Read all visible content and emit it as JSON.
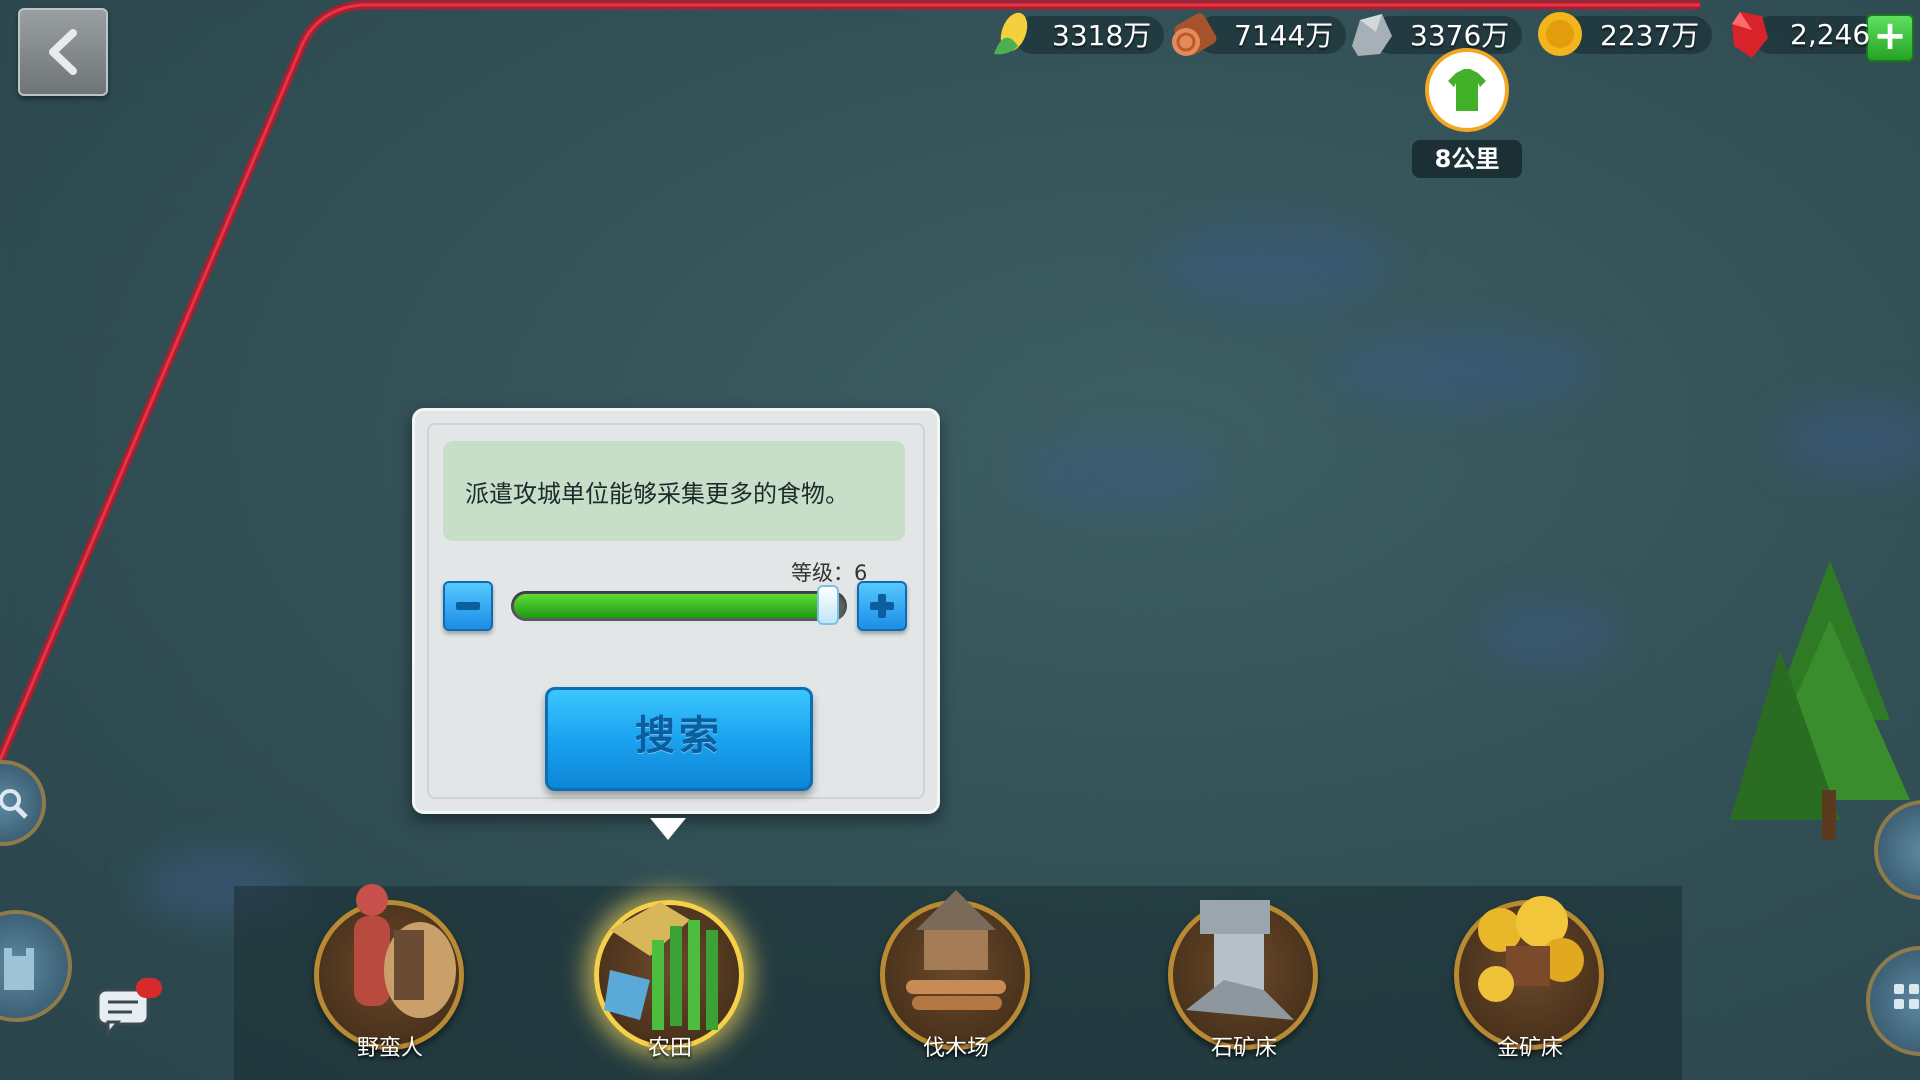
{
  "resources": [
    {
      "name": "food",
      "icon": "corn-icon",
      "value": "3318万"
    },
    {
      "name": "wood",
      "icon": "log-icon",
      "value": "7144万"
    },
    {
      "name": "stone",
      "icon": "stone-icon",
      "value": "3376万"
    },
    {
      "name": "gold",
      "icon": "gold-coin-icon",
      "value": "2237万"
    },
    {
      "name": "gems",
      "icon": "red-gem-icon",
      "value": "2,246"
    }
  ],
  "marker": {
    "distance_label": "8公里",
    "icon": "green-shirt-icon"
  },
  "search_panel": {
    "tip_text": "派遣攻城单位能够采集更多的食物。",
    "level_label": "等级：6",
    "level_fill": 0.95,
    "search_label": "搜索"
  },
  "categories": [
    {
      "id": "barbarian",
      "label": "野蛮人",
      "active": false
    },
    {
      "id": "farm",
      "label": "农田",
      "active": true
    },
    {
      "id": "lumber",
      "label": "伐木场",
      "active": false
    },
    {
      "id": "stone",
      "label": "石矿床",
      "active": false
    },
    {
      "id": "gold",
      "label": "金矿床",
      "active": false
    }
  ],
  "colors": {
    "territory_border": "#c0172a",
    "accent": "#1aa3f0",
    "highlight": "#f7d04a"
  }
}
